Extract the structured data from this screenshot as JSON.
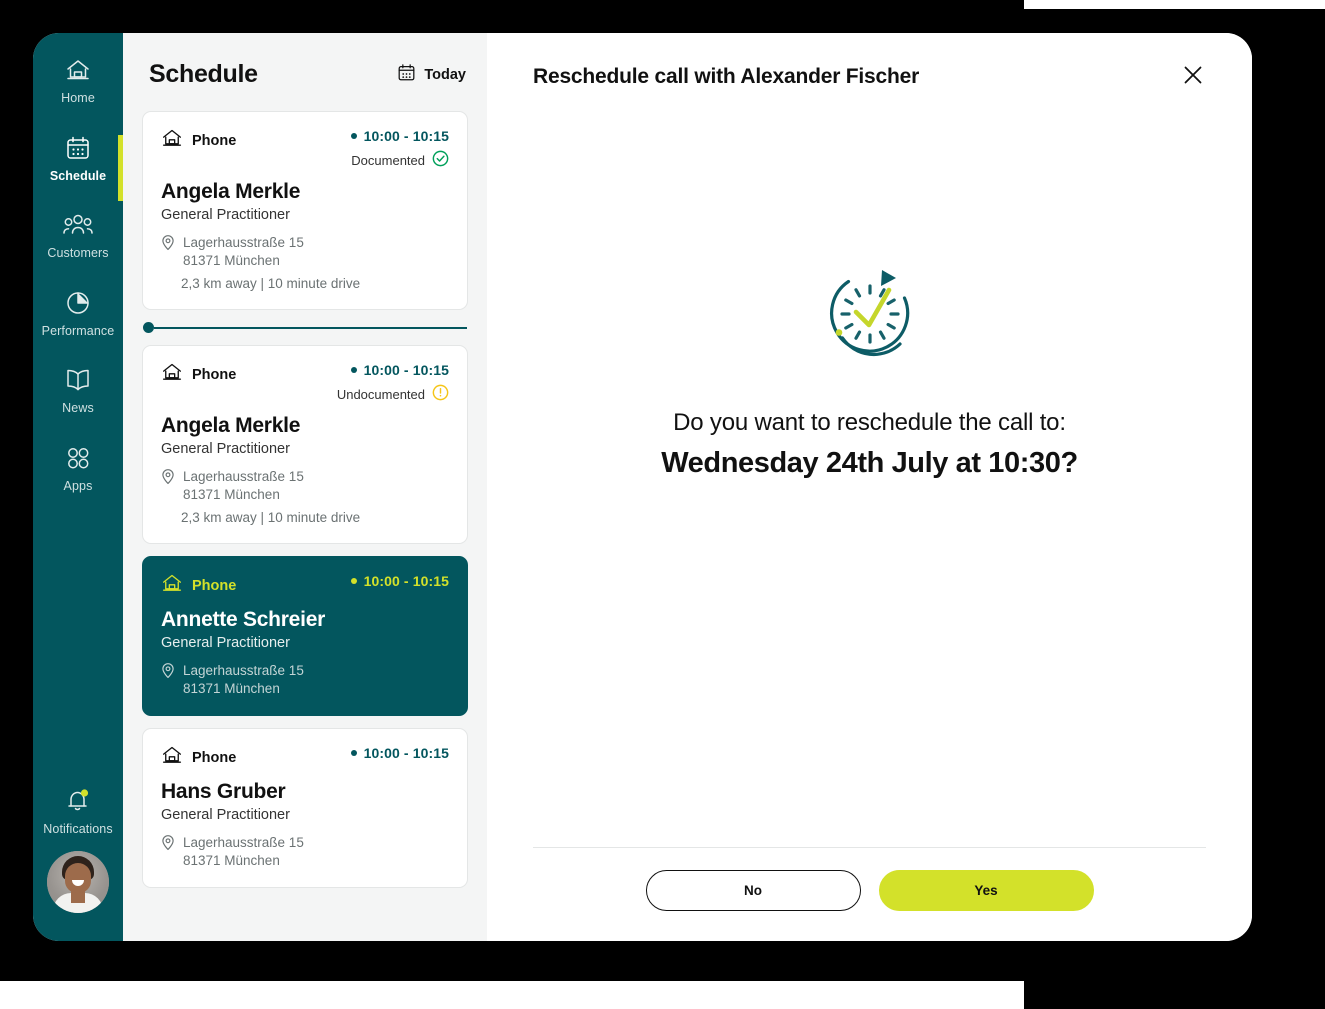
{
  "sidebar": {
    "items": [
      {
        "label": "Home",
        "icon": "home-icon",
        "active": false
      },
      {
        "label": "Schedule",
        "icon": "calendar-icon",
        "active": true
      },
      {
        "label": "Customers",
        "icon": "people-icon",
        "active": false
      },
      {
        "label": "Performance",
        "icon": "pie-chart-icon",
        "active": false
      },
      {
        "label": "News",
        "icon": "book-icon",
        "active": false
      },
      {
        "label": "Apps",
        "icon": "apps-grid-icon",
        "active": false
      }
    ],
    "notifications": {
      "label": "Notifications",
      "icon": "bell-icon",
      "has_badge": true
    },
    "avatar_alt": "User profile photo"
  },
  "schedule": {
    "title": "Schedule",
    "today_label": "Today",
    "today_icon": "calendar-icon",
    "cards": [
      {
        "type_label": "Phone",
        "time": "10:00 - 10:15",
        "status": "Documented",
        "status_icon": "check-circle-icon",
        "name": "Angela Merkle",
        "role": "General Practitioner",
        "address_line1": "Lagerhausstraße 15",
        "address_line2": "81371 München",
        "distance": "2,3 km away  |  10 minute drive",
        "selected": false
      },
      {
        "type_label": "Phone",
        "time": "10:00 - 10:15",
        "status": "Undocumented",
        "status_icon": "warning-circle-icon",
        "name": "Angela Merkle",
        "role": "General Practitioner",
        "address_line1": "Lagerhausstraße 15",
        "address_line2": "81371 München",
        "distance": "2,3 km away  |  10 minute drive",
        "selected": false
      },
      {
        "type_label": "Phone",
        "time": "10:00 - 10:15",
        "status": "",
        "status_icon": "",
        "name": "Annette Schreier",
        "role": "General Practitioner",
        "address_line1": "Lagerhausstraße 15",
        "address_line2": "81371 München",
        "distance": "",
        "selected": true
      },
      {
        "type_label": "Phone",
        "time": "10:00 - 10:15",
        "status": "",
        "status_icon": "",
        "name": "Hans Gruber",
        "role": "General Practitioner",
        "address_line1": "Lagerhausstraße 15",
        "address_line2": "81371 München",
        "distance": "",
        "selected": false
      }
    ]
  },
  "dialog": {
    "title": "Reschedule call with Alexander Fischer",
    "close_icon": "close-icon",
    "illustration_icon": "clock-reschedule-icon",
    "question": "Do you want to reschedule the call to:",
    "date_answer": "Wednesday 24th July at 10:30?",
    "no_label": "No",
    "yes_label": "Yes"
  },
  "colors": {
    "brand_teal": "#03565e",
    "accent_lime": "#d3e12a",
    "status_documented_green": "#00a05a",
    "status_undocumented_yellow": "#f5c518",
    "panel_bg": "#f4f5f5",
    "text_dark": "#111111"
  }
}
